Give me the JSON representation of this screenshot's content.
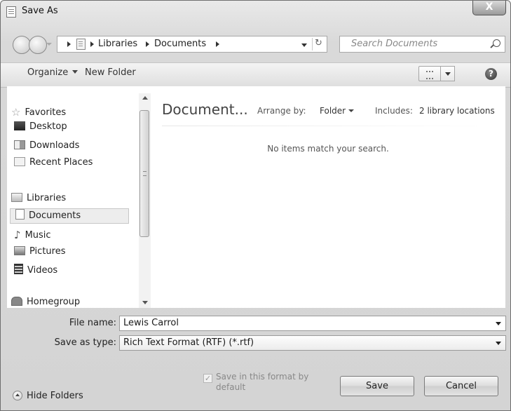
{
  "window": {
    "title": "Save As",
    "close_glyph": "X"
  },
  "address": {
    "crumbs": [
      "Libraries",
      "Documents"
    ],
    "refresh_glyph": "↻",
    "search_placeholder": "Search Documents"
  },
  "toolbar": {
    "organize": "Organize",
    "new_folder": "New Folder",
    "help_glyph": "?"
  },
  "nav": {
    "favorites": {
      "label": "Favorites",
      "items": [
        "Desktop",
        "Downloads",
        "Recent Places"
      ]
    },
    "libraries": {
      "label": "Libraries",
      "items": [
        "Documents",
        "Music",
        "Pictures",
        "Videos"
      ],
      "selected": "Documents"
    },
    "homegroup": "Homegroup"
  },
  "content": {
    "library_title": "Document...",
    "arrange_label": "Arrange by:",
    "arrange_value": "Folder",
    "includes_label": "Includes:",
    "includes_value": "2 library locations",
    "empty_message": "No items match your search."
  },
  "form": {
    "file_name_label": "File name:",
    "file_name_value": "Lewis Carrol",
    "save_type_label": "Save as type:",
    "save_type_value": "Rich Text Format (RTF) (*.rtf)",
    "save_format_checkbox": "Save in this format by default",
    "save_format_checked": true
  },
  "buttons": {
    "hide_folders": "Hide Folders",
    "save": "Save",
    "cancel": "Cancel"
  }
}
